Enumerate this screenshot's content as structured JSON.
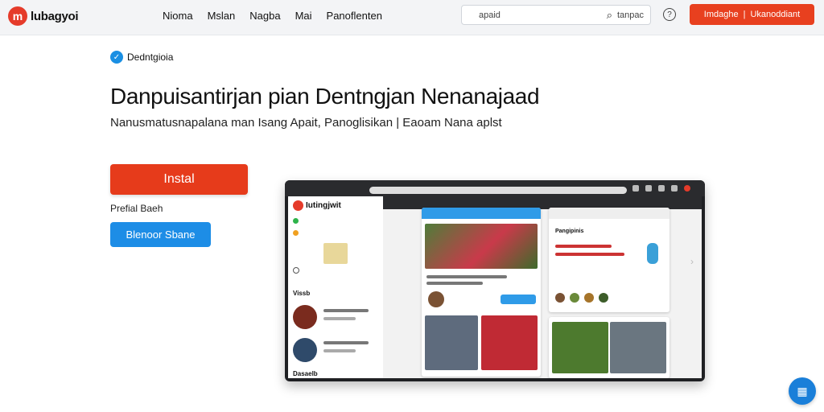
{
  "header": {
    "brand": "lubagyoi",
    "nav": [
      "Nioma",
      "Mslan",
      "Nagba",
      "Mai",
      "Panoflenten"
    ],
    "search_left": "apaid",
    "search_right": "tanpac",
    "cta_left": "Imdaghe",
    "cta_sep": "|",
    "cta_right": "Ukanoddiant"
  },
  "hero": {
    "badge": "Dedntgioia",
    "title": "Danpuisantirjan pian Dentngjan Nenanajaad",
    "subtitle": "Nanusmatusnapalana man Isang Apait, Panoglisikan | Eaoam Nana aplst",
    "install_label": "Instal",
    "secondary_link": "Prefial Baeh",
    "blue_button": "Blenoor Sbane"
  },
  "device": {
    "app_title": "Iutingjwit",
    "section_label_1": "Vissb",
    "section_label_2": "Dasaelb",
    "right_card_title": "Pangipinis"
  },
  "colors": {
    "accent_red": "#e63b1b",
    "accent_blue": "#1d8de6"
  },
  "icons": {
    "help": "question-icon",
    "search": "search-icon",
    "fab": "grid-menu-icon"
  }
}
